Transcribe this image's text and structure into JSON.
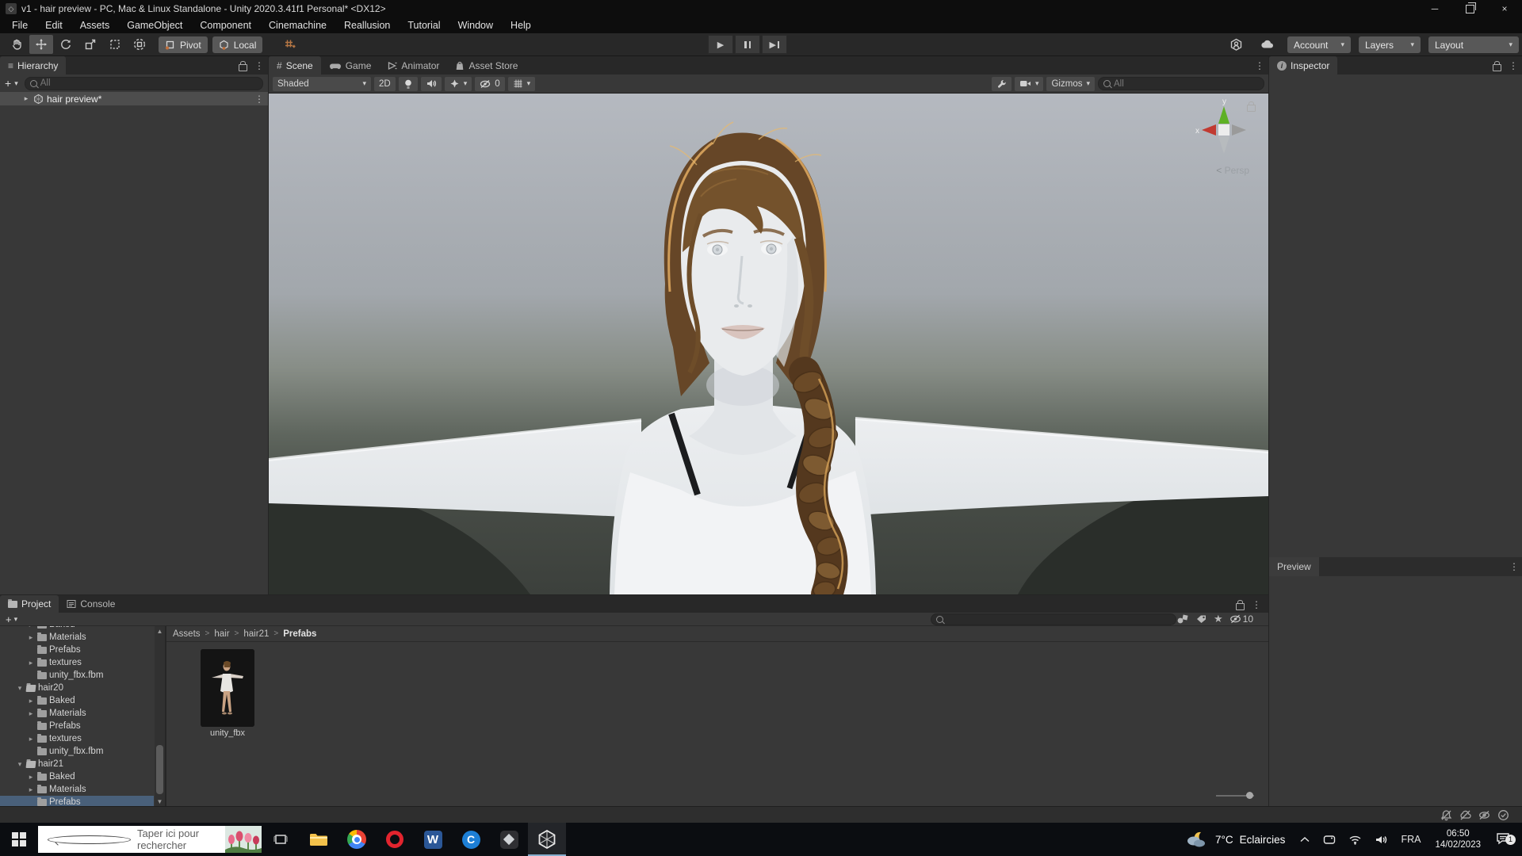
{
  "window": {
    "title": "v1 - hair preview - PC, Mac & Linux Standalone - Unity 2020.3.41f1 Personal* <DX12>"
  },
  "menu": {
    "items": [
      "File",
      "Edit",
      "Assets",
      "GameObject",
      "Component",
      "Cinemachine",
      "Reallusion",
      "Tutorial",
      "Window",
      "Help"
    ]
  },
  "toolbar": {
    "pivot": "Pivot",
    "local": "Local",
    "account": "Account",
    "layers": "Layers",
    "layout": "Layout"
  },
  "hierarchy": {
    "tab": "Hierarchy",
    "search_placeholder": "All",
    "scene_item": "hair preview*"
  },
  "scene": {
    "tabs": [
      "Scene",
      "Game",
      "Animator",
      "Asset Store"
    ],
    "shading": "Shaded",
    "mode_2d": "2D",
    "hidden_count": "0",
    "gizmos": "Gizmos",
    "search_placeholder": "All",
    "axis_x": "x",
    "axis_y": "y",
    "projection": "Persp"
  },
  "inspector": {
    "tab": "Inspector"
  },
  "preview": {
    "tab": "Preview"
  },
  "project": {
    "tab": "Project",
    "console_tab": "Console",
    "hidden_count": "10",
    "breadcrumb": [
      "Assets",
      "hair",
      "hair21",
      "Prefabs"
    ],
    "breadcrumb_sep": ">",
    "asset_label": "unity_fbx",
    "tree": [
      {
        "label": "Baked",
        "depth": 2,
        "arrow": "closed",
        "clipped": true
      },
      {
        "label": "Materials",
        "depth": 2,
        "arrow": "closed"
      },
      {
        "label": "Prefabs",
        "depth": 2,
        "arrow": "none"
      },
      {
        "label": "textures",
        "depth": 2,
        "arrow": "closed"
      },
      {
        "label": "unity_fbx.fbm",
        "depth": 2,
        "arrow": "none"
      },
      {
        "label": "hair20",
        "depth": 1,
        "arrow": "open",
        "open": true
      },
      {
        "label": "Baked",
        "depth": 2,
        "arrow": "closed"
      },
      {
        "label": "Materials",
        "depth": 2,
        "arrow": "closed"
      },
      {
        "label": "Prefabs",
        "depth": 2,
        "arrow": "none"
      },
      {
        "label": "textures",
        "depth": 2,
        "arrow": "closed"
      },
      {
        "label": "unity_fbx.fbm",
        "depth": 2,
        "arrow": "none"
      },
      {
        "label": "hair21",
        "depth": 1,
        "arrow": "open",
        "open": true
      },
      {
        "label": "Baked",
        "depth": 2,
        "arrow": "closed"
      },
      {
        "label": "Materials",
        "depth": 2,
        "arrow": "closed"
      },
      {
        "label": "Prefabs",
        "depth": 2,
        "arrow": "none",
        "selected": true
      }
    ]
  },
  "taskbar": {
    "search_placeholder": "Taper ici pour rechercher",
    "language": "FRA",
    "time": "06:50",
    "date": "14/02/2023",
    "weather_temp": "7°C",
    "weather_condition": "Eclaircies",
    "notification_badge": "1"
  },
  "colors": {
    "panel": "#383838",
    "chrome": "#282828",
    "titlebar": "#0d0d0d",
    "selection_gray": "#4d4d4d",
    "selection_blue": "#49607a",
    "axis_y_green": "#5eb024",
    "axis_x_red": "#c13a31",
    "button": "#585858",
    "taskbar": "#0b0d11"
  }
}
